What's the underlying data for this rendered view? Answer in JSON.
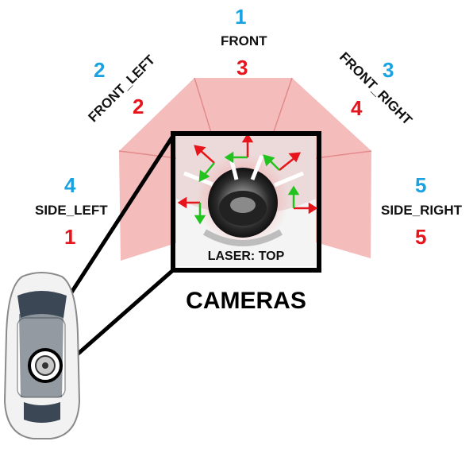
{
  "colors": {
    "cam_index_blue": "#1aa3e0",
    "laser_index_red": "#e8141b",
    "fov": "#f2a6a6",
    "frame": "#000000"
  },
  "cameras": [
    {
      "id": "front",
      "name": "FRONT",
      "cam_index": "1",
      "laser_index": "3"
    },
    {
      "id": "front_left",
      "name": "FRONT_LEFT",
      "cam_index": "2",
      "laser_index": "2"
    },
    {
      "id": "front_right",
      "name": "FRONT_RIGHT",
      "cam_index": "3",
      "laser_index": "4"
    },
    {
      "id": "side_left",
      "name": "SIDE_LEFT",
      "cam_index": "4",
      "laser_index": "1"
    },
    {
      "id": "side_right",
      "name": "SIDE_RIGHT",
      "cam_index": "5",
      "laser_index": "5"
    }
  ],
  "laser_label": "LASER: TOP",
  "title": "CAMERAS",
  "icons": {
    "car": "car-top-view-icon",
    "sensor": "lidar-sensor-icon"
  }
}
